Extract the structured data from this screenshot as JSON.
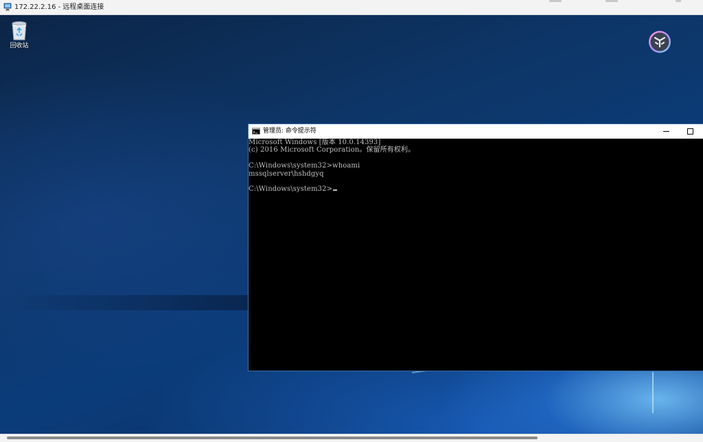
{
  "rdp_window": {
    "title": "172.22.2.16 - 远程桌面连接",
    "controls": {
      "minimize_icon": "minimize-icon",
      "maximize_icon": "maximize-icon",
      "close_icon": "close-icon"
    },
    "horizontal_scrollbar": {
      "thumb_fraction": 0.77
    }
  },
  "desktop": {
    "icons": [
      {
        "label": "回收站",
        "icon": "recycle-bin-icon"
      }
    ],
    "widgets": {
      "top_right_icon": "circular-widget-icon",
      "bottom_right_icon": "bird-app-icon"
    }
  },
  "cmd_window": {
    "title": "管理员: 命令提示符",
    "icon": "cmd-icon",
    "lines": [
      "Microsoft Windows [版本 10.0.14393]",
      "(c) 2016 Microsoft Corporation。保留所有权利。",
      "",
      "C:\\Windows\\system32>whoami",
      "mssqlserver\\hshdgyq",
      "",
      "C:\\Windows\\system32>"
    ]
  },
  "colors": {
    "console_bg": "#000000",
    "console_text": "#c0c0c0",
    "titlebar_bg": "#ffffff",
    "rdp_titlebar_bg": "#f3f3f3",
    "desktop_blue": "#0b3c7a"
  }
}
